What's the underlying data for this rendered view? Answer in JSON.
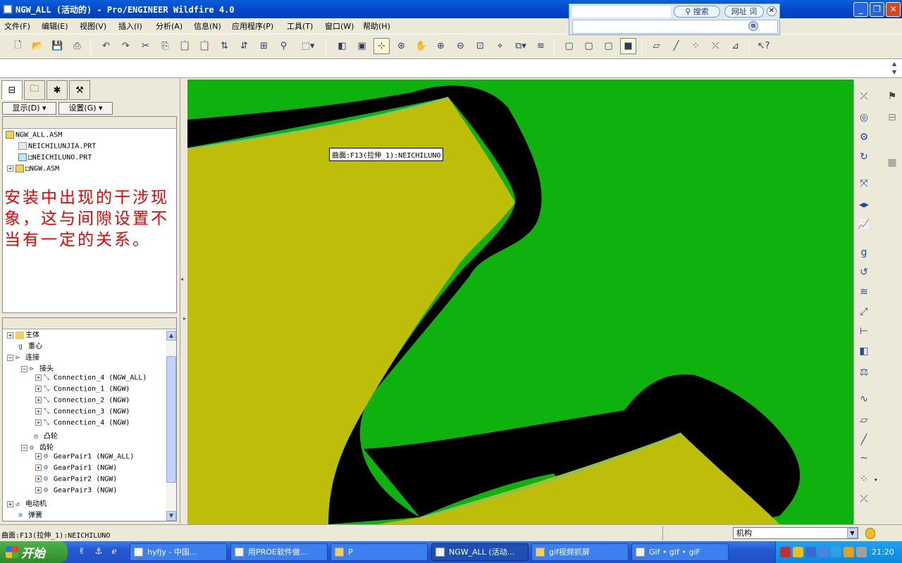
{
  "window": {
    "title": "NGW_ALL (活动的) - Pro/ENGINEER Wildfire 4.0"
  },
  "search": {
    "search_label": "搜索",
    "url_label": "网址",
    "word_label": "词"
  },
  "menu": [
    "文件(F)",
    "编辑(E)",
    "视图(V)",
    "插入(I)",
    "分析(A)",
    "信息(N)",
    "应用程序(P)",
    "工具(T)",
    "窗口(W)",
    "帮助(H)"
  ],
  "panel": {
    "show_label": "显示(D) ▾",
    "settings_label": "设置(G) ▾",
    "model_tree": [
      {
        "label": "NGW_ALL.ASM"
      },
      {
        "label": "NEICHILUNJIA.PRT"
      },
      {
        "label": "□NEICHILUNO.PRT"
      },
      {
        "label": "□NGW.ASM"
      }
    ],
    "note": "安装中出现的干涉现象，这与间隙设置不当有一定的关系。",
    "mech_tree": [
      {
        "label": "主体"
      },
      {
        "label": "重心"
      },
      {
        "label": "连接"
      },
      {
        "label": "接头"
      },
      {
        "label": "Connection_4  (NGW_ALL)"
      },
      {
        "label": "Connection_1  (NGW)"
      },
      {
        "label": "Connection_2  (NGW)"
      },
      {
        "label": "Connection_3  (NGW)"
      },
      {
        "label": "Connection_4  (NGW)"
      },
      {
        "label": "凸轮"
      },
      {
        "label": "齿轮"
      },
      {
        "label": "GearPair1  (NGW_ALL)"
      },
      {
        "label": "GearPair1  (NGW)"
      },
      {
        "label": "GearPair2  (NGW)"
      },
      {
        "label": "GearPair3  (NGW)"
      },
      {
        "label": "电动机"
      },
      {
        "label": "弹簧"
      }
    ]
  },
  "viewport": {
    "tooltip": "曲面:F13(拉伸_1):NEICHILUNO"
  },
  "colors": {
    "background": "#0fb10f",
    "part": "#bebe0a",
    "interference": "#000000"
  },
  "status": {
    "message": "曲面:F13(拉伸_1):NEICHILUNO",
    "mode_select": "机构"
  },
  "taskbar": {
    "start_label": "开始",
    "tasks": [
      "hyfjy - 中国...",
      "用PROE软件做...",
      "P",
      "NGW_ALL (活动...",
      "gif视频抓屏",
      "Gif • gIf • giF"
    ],
    "clock": "21:20"
  }
}
